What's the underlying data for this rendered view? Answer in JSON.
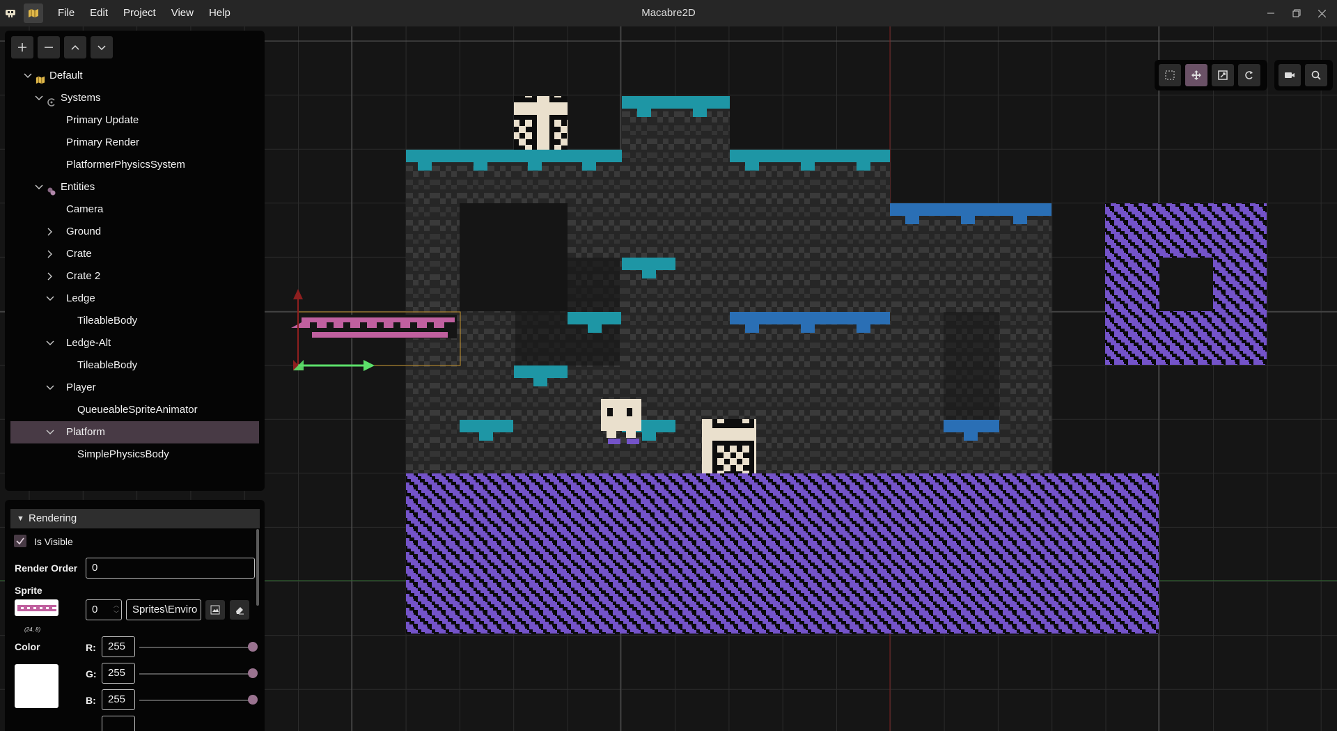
{
  "titlebar": {
    "title": "Macabre2D",
    "menus": [
      "File",
      "Edit",
      "Project",
      "View",
      "Help"
    ]
  },
  "tree": {
    "rows": [
      {
        "label": "Default",
        "depth": 0,
        "expanded": true,
        "icon": "scene-icon"
      },
      {
        "label": "Systems",
        "depth": 1,
        "expanded": true,
        "icon": "systems-icon"
      },
      {
        "label": "Primary Update",
        "depth": 2
      },
      {
        "label": "Primary Render",
        "depth": 2
      },
      {
        "label": "PlatformerPhysicsSystem",
        "depth": 2
      },
      {
        "label": "Entities",
        "depth": 1,
        "expanded": true,
        "icon": "entities-icon"
      },
      {
        "label": "Camera",
        "depth": 2
      },
      {
        "label": "Ground",
        "depth": 2,
        "expanded": false
      },
      {
        "label": "Crate",
        "depth": 2,
        "expanded": false
      },
      {
        "label": "Crate 2",
        "depth": 2,
        "expanded": false
      },
      {
        "label": "Ledge",
        "depth": 2,
        "expanded": true
      },
      {
        "label": "TileableBody",
        "depth": 3
      },
      {
        "label": "Ledge-Alt",
        "depth": 2,
        "expanded": true
      },
      {
        "label": "TileableBody",
        "depth": 3
      },
      {
        "label": "Player",
        "depth": 2,
        "expanded": true
      },
      {
        "label": "QueueableSpriteAnimator",
        "depth": 3
      },
      {
        "label": "Platform",
        "depth": 2,
        "expanded": true,
        "selected": true
      },
      {
        "label": "SimplePhysicsBody",
        "depth": 3
      }
    ]
  },
  "props": {
    "section": "Rendering",
    "is_visible_label": "Is Visible",
    "is_visible": true,
    "render_order_label": "Render Order",
    "render_order": "0",
    "sprite_label": "Sprite",
    "sprite_index": "0",
    "sprite_path": "Sprites\\Enviro",
    "sprite_size": "(24, 8)",
    "color_label": "Color",
    "r_label": "R:",
    "g_label": "G:",
    "b_label": "B:",
    "r": "255",
    "g": "255",
    "b": "255"
  },
  "colors": {
    "teal": "#1e96a5",
    "blue": "#2a6fb5",
    "purple": "#7453c9",
    "pink": "#c0609f",
    "brick_light": "#3a3a3a",
    "brick_dark": "#262626",
    "crate": "#eae0cd",
    "selection": "#483a45",
    "accent": "#9a7390"
  }
}
